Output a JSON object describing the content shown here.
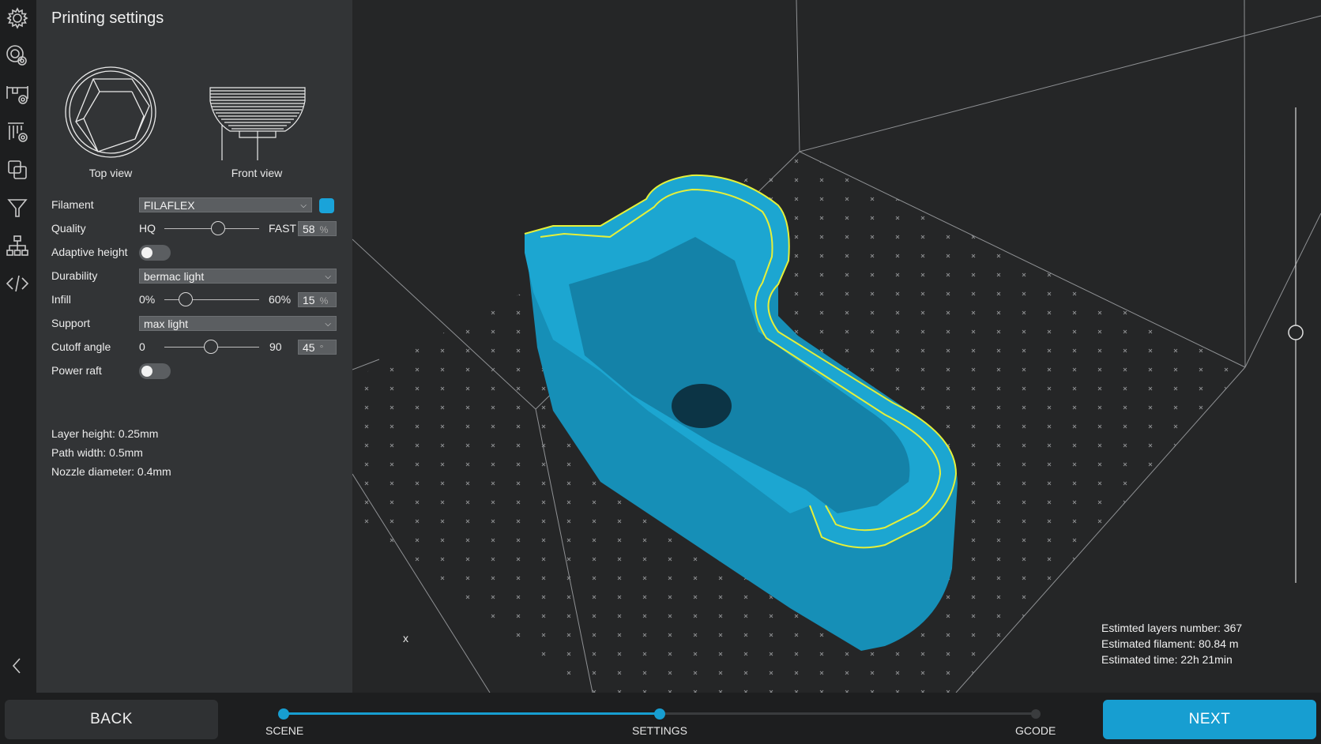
{
  "sidebar": {
    "icons": [
      "gear-icon",
      "print-settings-icon",
      "printer-settings-icon",
      "support-settings-icon",
      "copy-icon",
      "filter-icon",
      "hierarchy-icon",
      "code-icon",
      "collapse-icon"
    ]
  },
  "panel": {
    "title": "Printing settings",
    "top_view_label": "Top view",
    "front_view_label": "Front view",
    "filament": {
      "label": "Filament",
      "value": "FILAFLEX",
      "color": "#1aa3d9"
    },
    "quality": {
      "label": "Quality",
      "min_label": "HQ",
      "max_label": "FAST",
      "value": "58",
      "unit": "%",
      "fraction": 0.58
    },
    "adaptive_height": {
      "label": "Adaptive height",
      "on": false
    },
    "durability": {
      "label": "Durability",
      "value": "bermac light"
    },
    "infill": {
      "label": "Infill",
      "min_label": "0%",
      "max_label": "60%",
      "value": "15",
      "unit": "%",
      "fraction": 0.25
    },
    "support": {
      "label": "Support",
      "value": "max light"
    },
    "cutoff_angle": {
      "label": "Cutoff angle",
      "min_label": "0",
      "max_label": "90",
      "value": "45",
      "unit": "°",
      "fraction": 0.5
    },
    "power_raft": {
      "label": "Power raft",
      "on": false
    },
    "layer_height": "Layer height: 0.25mm",
    "path_width": "Path width: 0.5mm",
    "nozzle_diameter": "Nozzle diameter: 0.4mm"
  },
  "viewport": {
    "axis_label": "x",
    "layer_slider_fraction": 0.5,
    "stats": {
      "layers": "Estimted layers number: 367",
      "filament": "Estimated filament: 80.84 m",
      "time": "Estimated time: 22h 21min"
    },
    "model_color": "#1b9fc9",
    "outline_color": "#e5f03a"
  },
  "footer": {
    "back_label": "BACK",
    "next_label": "NEXT",
    "steps": [
      "SCENE",
      "SETTINGS",
      "GCODE"
    ],
    "current_step": 1,
    "accent": "#179ed1"
  }
}
